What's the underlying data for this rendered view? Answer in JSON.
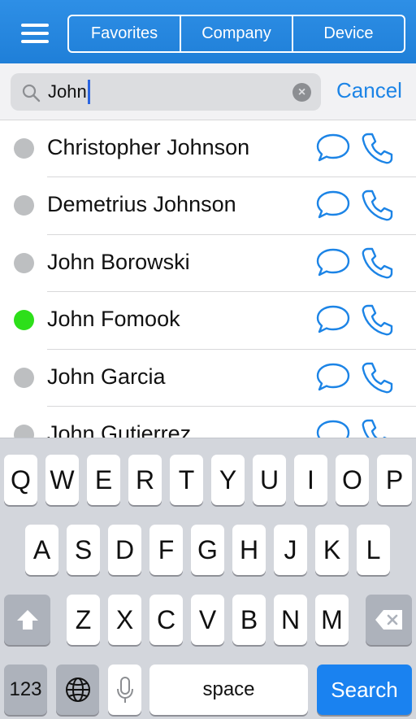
{
  "header": {
    "segments": [
      {
        "label": "Favorites"
      },
      {
        "label": "Company"
      },
      {
        "label": "Device"
      }
    ]
  },
  "search": {
    "value": "John",
    "cancel_label": "Cancel"
  },
  "contacts": [
    {
      "name": "Christopher Johnson",
      "status_color": "#bdbfc1"
    },
    {
      "name": "Demetrius Johnson",
      "status_color": "#bdbfc1"
    },
    {
      "name": "John Borowski",
      "status_color": "#bdbfc1"
    },
    {
      "name": "John Fomook",
      "status_color": "#2ddf1a"
    },
    {
      "name": "John Garcia",
      "status_color": "#bdbfc1"
    },
    {
      "name": "John Gutierrez",
      "status_color": "#bdbfc1"
    }
  ],
  "keyboard": {
    "row1": [
      "Q",
      "W",
      "E",
      "R",
      "T",
      "Y",
      "U",
      "I",
      "O",
      "P"
    ],
    "row2": [
      "A",
      "S",
      "D",
      "F",
      "G",
      "H",
      "J",
      "K",
      "L"
    ],
    "row3": [
      "Z",
      "X",
      "C",
      "V",
      "B",
      "N",
      "M"
    ],
    "numbers_label": "123",
    "space_label": "space",
    "search_label": "Search",
    "icons": {
      "shift": "shift-icon",
      "backspace": "backspace-icon",
      "globe": "globe-icon",
      "mic": "microphone-icon"
    }
  },
  "colors": {
    "accent": "#1c84e6",
    "header": "#2585de",
    "online": "#2ddf1a",
    "offline": "#bdbfc1"
  }
}
